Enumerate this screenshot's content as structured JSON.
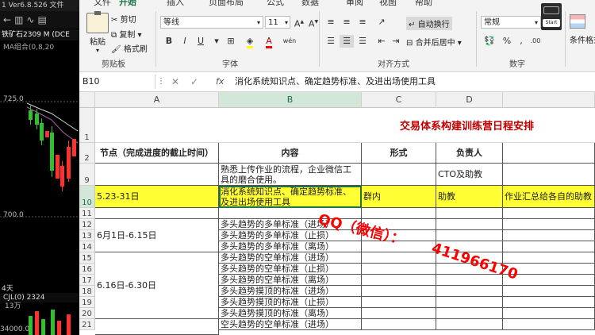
{
  "trade": {
    "header": "1 Ver6.8.526",
    "header_extra": "文件",
    "symbol": "铁矿石2309",
    "symbol_code": "M (DCE",
    "ma": "MA组合(0,8,20",
    "price_top": "725.0",
    "price_mid": "700.0",
    "period": "4天",
    "vol_label": "13万",
    "cjl": "CJL(0)",
    "cjl_val": "2324",
    "bottom_num": "34000.0"
  },
  "ribbon": {
    "tabs": [
      "文件",
      "开始",
      "插入",
      "页面布局",
      "公式",
      "数据",
      "审阅",
      "视图",
      "帮助"
    ],
    "active_tab": "开始",
    "clipboard": {
      "paste": "粘贴",
      "cut": "剪切",
      "copy": "复制",
      "format_painter": "格式刷",
      "label": "剪贴板"
    },
    "font": {
      "name": "等线",
      "size": "11",
      "bold": "B",
      "italic": "I",
      "underline": "U",
      "label": "字体"
    },
    "align": {
      "wrap": "自动换行",
      "merge": "合并后居中",
      "label": "对齐方式"
    },
    "number": {
      "format": "常规",
      "label": "数字"
    },
    "styles": {
      "cond": "条件格式"
    },
    "start_badge": "Start"
  },
  "formula_bar": {
    "name_box": "B10",
    "fx": "fx",
    "content": "消化系统知识点、确定趋势标准、及进出场使用工具"
  },
  "grid": {
    "columns": [
      "A",
      "B",
      "C",
      "D"
    ],
    "title": "交易体系构建训练营日程安排",
    "headers": {
      "a": "节点（完成进度的截止时间）",
      "b": "内容",
      "c": "形式",
      "d": "负责人"
    },
    "row9": {
      "b1": "熟悉上传作业的流程，企业微信工",
      "b2": "具的磨合使用。",
      "d": "CTO及助教"
    },
    "row10": {
      "a": "5.23-31日",
      "b1": "消化系统知识点、确定趋势标准、",
      "b2": "及进出场使用工具",
      "c": "群内",
      "d": "助教",
      "e": "作业汇总给各自的助教"
    },
    "group1": "6月1日-6.15日",
    "group2": "6.16日-6.30日",
    "rows": [
      {
        "num": "12",
        "b": "多头趋势的多单标准（进场）"
      },
      {
        "num": "13",
        "b": "多头趋势的多单标准（止损）"
      },
      {
        "num": "14",
        "b": "多头趋势的多单标准（离场）"
      },
      {
        "num": "15",
        "b": "多头趋势的空单标准（进场）"
      },
      {
        "num": "16",
        "b": "多头趋势的空单标准（止损）"
      },
      {
        "num": "17",
        "b": "多头趋势的空单标准（离场）"
      },
      {
        "num": "18",
        "b": "多头趋势摸顶的标准（进场）"
      },
      {
        "num": "19",
        "b": "多头趋势摸顶的标准（止损）"
      },
      {
        "num": "20",
        "b": "多头趋势摸顶的标准（离场）"
      },
      {
        "num": "21",
        "b": "空头趋势的空单标准（进场）"
      }
    ],
    "row_nums": {
      "r1": "1",
      "r2": "2",
      "r9": "9",
      "r10": "10",
      "r11": "11"
    }
  },
  "watermark": {
    "qq": "QQ（微信）：",
    "number": "411966170"
  }
}
